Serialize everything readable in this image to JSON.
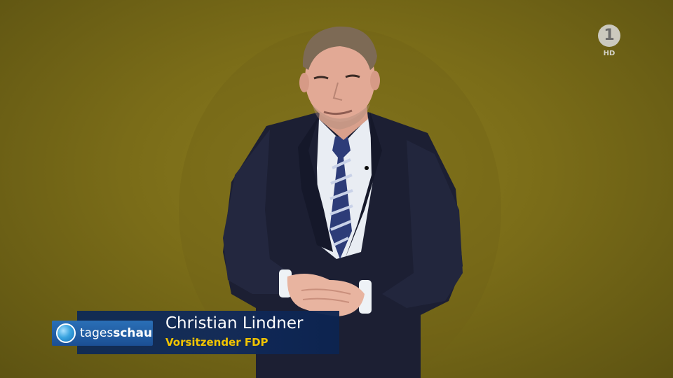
{
  "broadcast": {
    "channel_logo": {
      "mark": "1",
      "quality": "HD"
    },
    "brand": {
      "part1": "tages",
      "part2": "schau",
      "icon": "tagesschau-globe-icon"
    },
    "lower_third": {
      "name": "Christian Lindner",
      "title": "Vorsitzender FDP"
    }
  },
  "colors": {
    "background": "#7a6c18",
    "lower_third_bar": "#0e2a55",
    "brand_blue": "#2a6fb6",
    "title_yellow": "#f2c400"
  }
}
